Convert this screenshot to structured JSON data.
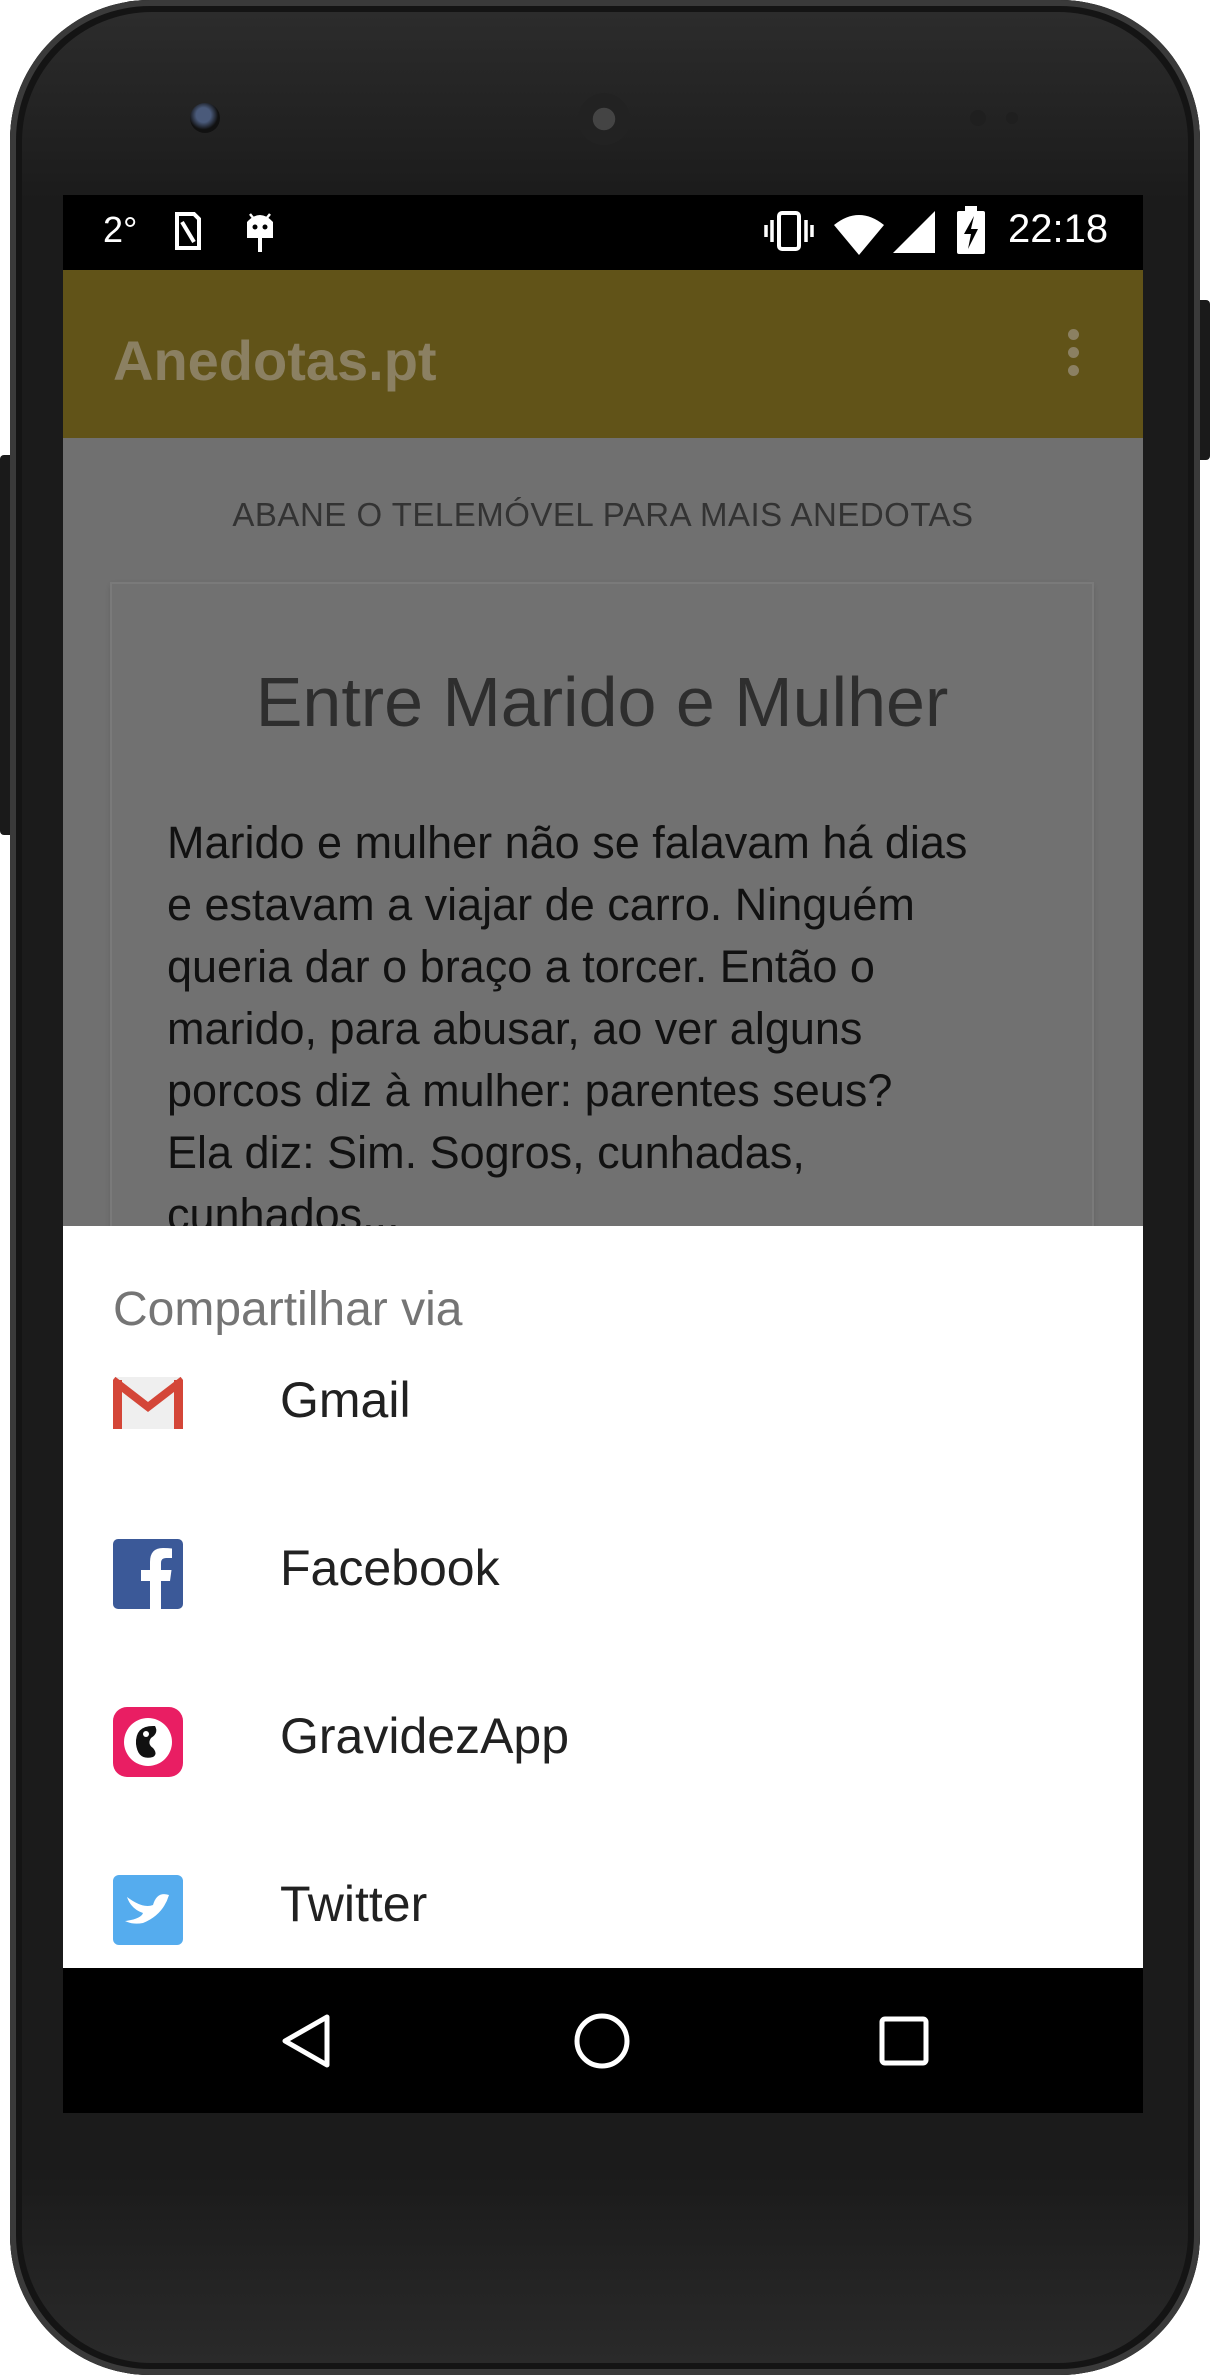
{
  "status_bar": {
    "temperature": "2°",
    "time": "22:18",
    "icons": [
      "sim-icon",
      "android-icon",
      "vibrate-icon",
      "wifi-icon",
      "signal-icon",
      "battery-charging-icon"
    ]
  },
  "app_bar": {
    "title": "Anedotas.pt",
    "menu_icon": "overflow-menu-icon",
    "color": "#615318"
  },
  "main": {
    "shake_hint": "ABANE O TELEMÓVEL PARA MAIS ANEDOTAS",
    "joke": {
      "title": "Entre Marido e Mulher",
      "body": "Marido e mulher não se falavam há dias\ne estavam a viajar de carro. Ninguém\nqueria dar o braço a torcer. Então o\nmarido, para abusar, ao ver alguns\nporcos diz à mulher: parentes seus?\nEla diz: Sim. Sogros, cunhadas,\ncunhados..."
    }
  },
  "share_sheet": {
    "title": "Compartilhar via",
    "items": [
      {
        "label": "Gmail",
        "icon": "gmail-icon"
      },
      {
        "label": "Facebook",
        "icon": "facebook-icon"
      },
      {
        "label": "GravidezApp",
        "icon": "gravidezapp-icon"
      },
      {
        "label": "Twitter",
        "icon": "twitter-icon"
      }
    ]
  },
  "nav_bar": {
    "buttons": [
      "back-icon",
      "home-icon",
      "recents-icon"
    ]
  }
}
